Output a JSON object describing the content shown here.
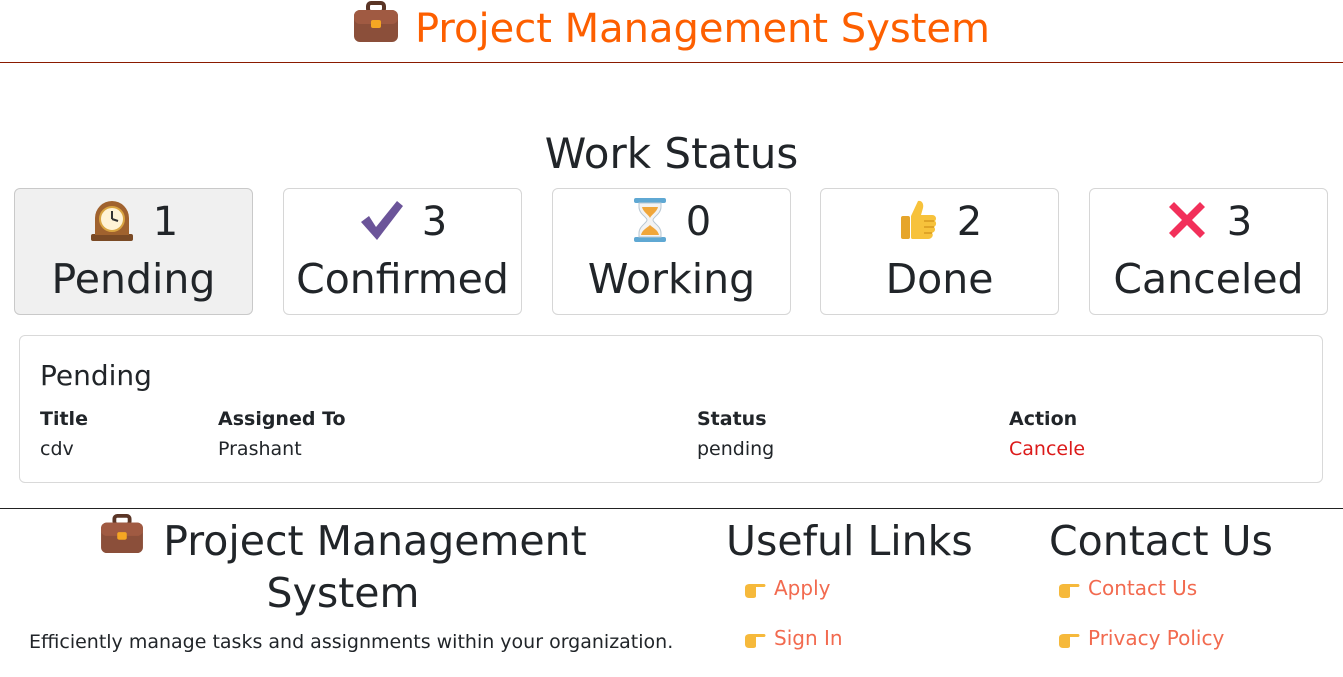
{
  "header": {
    "title": "Project Management System",
    "icon": "briefcase-icon",
    "color": "#fd5f00"
  },
  "work_status": {
    "title": "Work Status",
    "cards": [
      {
        "label": "Pending",
        "count": "1",
        "icon": "mantel-clock-icon",
        "active": true
      },
      {
        "label": "Confirmed",
        "count": "3",
        "icon": "check-mark-icon",
        "active": false
      },
      {
        "label": "Working",
        "count": "0",
        "icon": "hourglass-icon",
        "active": false
      },
      {
        "label": "Done",
        "count": "2",
        "icon": "thumbs-up-icon",
        "active": false
      },
      {
        "label": "Canceled",
        "count": "3",
        "icon": "cross-mark-icon",
        "active": false
      }
    ]
  },
  "table": {
    "title": "Pending",
    "columns": [
      "Title",
      "Assigned To",
      "Status",
      "Action"
    ],
    "rows": [
      {
        "title": "cdv",
        "assigned_to": "Prashant",
        "status": "pending",
        "action": "Cancele"
      }
    ]
  },
  "footer": {
    "brand": "Project Management System",
    "brand_line1": "Project Management",
    "brand_line2": "System",
    "description": "Efficiently manage tasks and assignments within your organization.",
    "useful_links": {
      "title": "Useful Links",
      "items": [
        "Apply",
        "Sign In"
      ]
    },
    "contact": {
      "title": "Contact Us",
      "items": [
        "Contact Us",
        "Privacy Policy"
      ]
    },
    "link_color": "#f26a4f",
    "link_icon": "pointing-hand-icon"
  }
}
